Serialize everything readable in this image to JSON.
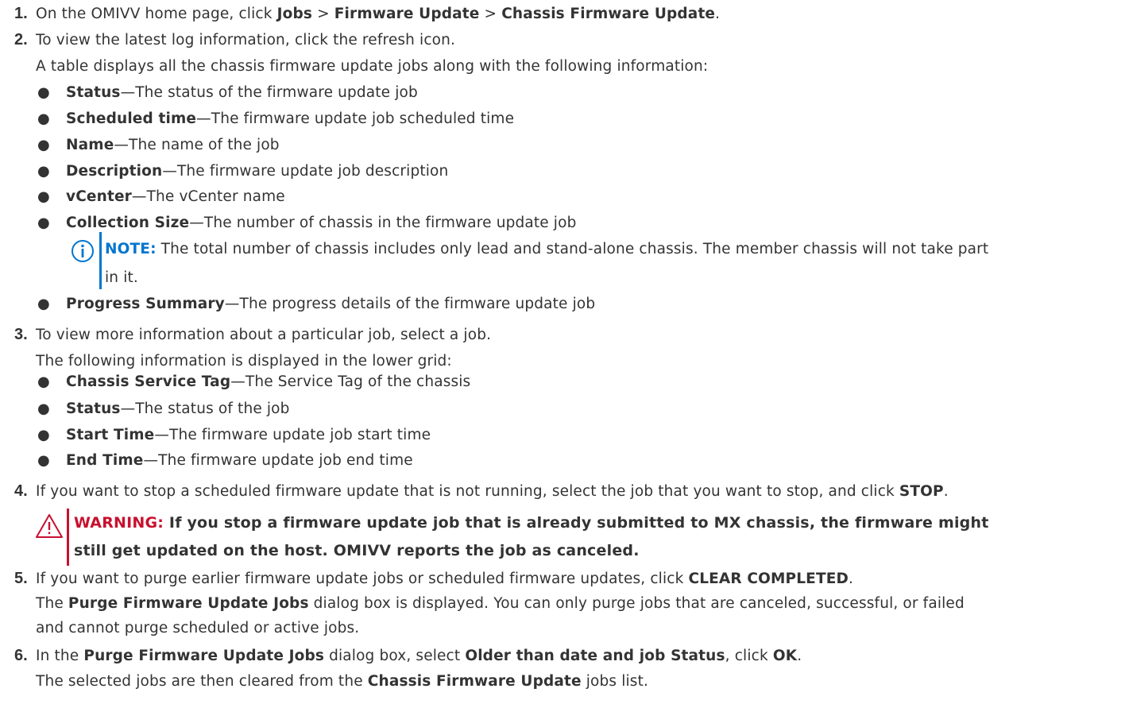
{
  "steps": [
    {
      "number": "1.",
      "lines": [
        [
          "On the OMIVV home page, click ",
          {
            "b": "Jobs"
          },
          " > ",
          {
            "b": "Firmware Update"
          },
          " > ",
          {
            "b": "Chassis Firmware Update"
          },
          "."
        ]
      ]
    },
    {
      "number": "2.",
      "lines": [
        [
          "To view the latest log information, click the refresh icon."
        ],
        [
          "A table displays all the chassis firmware update jobs along with the following information:"
        ]
      ]
    },
    {
      "number": "3.",
      "lines": [
        [
          "To view more information about a particular job, select a job."
        ],
        [
          "The following information is displayed in the lower grid:"
        ]
      ]
    },
    {
      "number": "4.",
      "lines": [
        [
          "If you want to stop a scheduled firmware update that is not running, select the job that you want to stop, and click ",
          {
            "b": "STOP"
          },
          "."
        ]
      ]
    },
    {
      "number": "5.",
      "lines": [
        [
          "If you want to purge earlier firmware update jobs or scheduled firmware updates, click ",
          {
            "b": "CLEAR COMPLETED"
          },
          "."
        ],
        [
          "The ",
          {
            "b": "Purge Firmware Update Jobs"
          },
          " dialog box is displayed. You can only purge jobs that are canceled, successful, or failed"
        ],
        [
          "and cannot purge scheduled or active jobs."
        ]
      ]
    },
    {
      "number": "6.",
      "lines": [
        [
          "In the ",
          {
            "b": "Purge Firmware Update Jobs"
          },
          " dialog box, select ",
          {
            "b": "Older than date and job Status"
          },
          ", click ",
          {
            "b": "OK"
          },
          "."
        ],
        [
          "The selected jobs are then cleared from the ",
          {
            "b": "Chassis Firmware Update"
          },
          " jobs list."
        ]
      ]
    }
  ],
  "bullets_step2": [
    {
      "term": "Status",
      "desc": "—The status of the firmware update job"
    },
    {
      "term": "Scheduled time",
      "desc": "—The firmware update job scheduled time"
    },
    {
      "term": "Name",
      "desc": "—The name of the job"
    },
    {
      "term": "Description",
      "desc": "—The firmware update job description"
    },
    {
      "term": "vCenter",
      "desc": "—The vCenter name"
    },
    {
      "term": "Collection Size",
      "desc": "—The number of chassis in the firmware update job"
    },
    {
      "term": "Progress Summary",
      "desc": "—The progress details of the firmware update job"
    }
  ],
  "bullets_step3": [
    {
      "term": "Chassis Service Tag",
      "desc": "—The Service Tag of the chassis"
    },
    {
      "term": "Status",
      "desc": "—The status of the job"
    },
    {
      "term": "Start Time",
      "desc": "—The firmware update job start time"
    },
    {
      "term": "End Time",
      "desc": "—The firmware update job end time"
    }
  ],
  "bullet_char": "●",
  "note": {
    "label": "NOTE:",
    "line1": " The total number of chassis includes only lead and stand-alone chassis. The member chassis will not take part",
    "line2": "in it.",
    "icon": "info-circle-icon",
    "color": "#0076ce"
  },
  "warning": {
    "label": "WARNING:",
    "line1": " If you stop a firmware update job that is already submitted to MX chassis, the firmware might",
    "line2": "still get updated on the host. OMIVV reports the job as canceled.",
    "icon": "warning-triangle-icon",
    "color": "#c8102e"
  }
}
